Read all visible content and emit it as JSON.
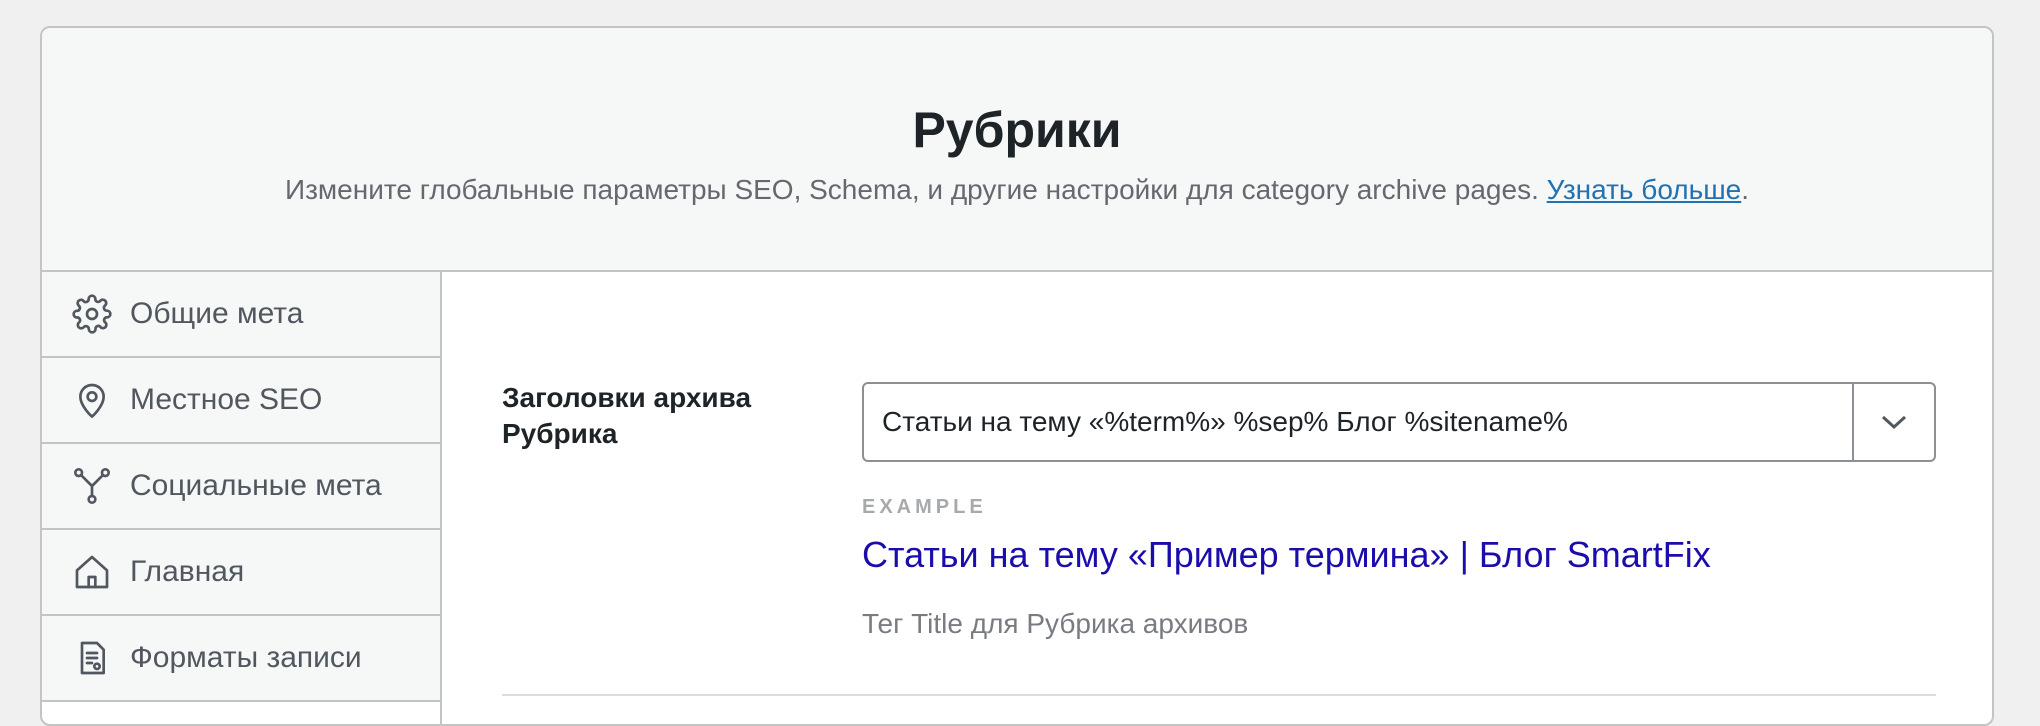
{
  "header": {
    "title": "Рубрики",
    "subtitle_text": "Измените глобальные параметры SEO, Schema, и другие настройки для category archive pages. ",
    "learn_more_link": "Узнать больше",
    "subtitle_end": "."
  },
  "sidebar": {
    "items": [
      {
        "label": "Общие мета",
        "icon": "gear-icon"
      },
      {
        "label": "Местное SEO",
        "icon": "location-pin-icon"
      },
      {
        "label": "Социальные мета",
        "icon": "social-network-icon"
      },
      {
        "label": "Главная",
        "icon": "home-icon"
      },
      {
        "label": "Форматы записи",
        "icon": "document-icon"
      }
    ]
  },
  "field": {
    "label": "Заголовки архива Рубрика",
    "value": "Статьи на тему «%term%» %sep% Блог %sitename%",
    "example_label": "EXAMPLE",
    "example_title": "Статьи на тему «Пример термина» | Блог SmartFix",
    "help_text": "Тег Title для Рубрика архивов"
  },
  "colors": {
    "link": "#2271b1",
    "example_title": "#1a0dab",
    "border": "#c3c4c7"
  }
}
